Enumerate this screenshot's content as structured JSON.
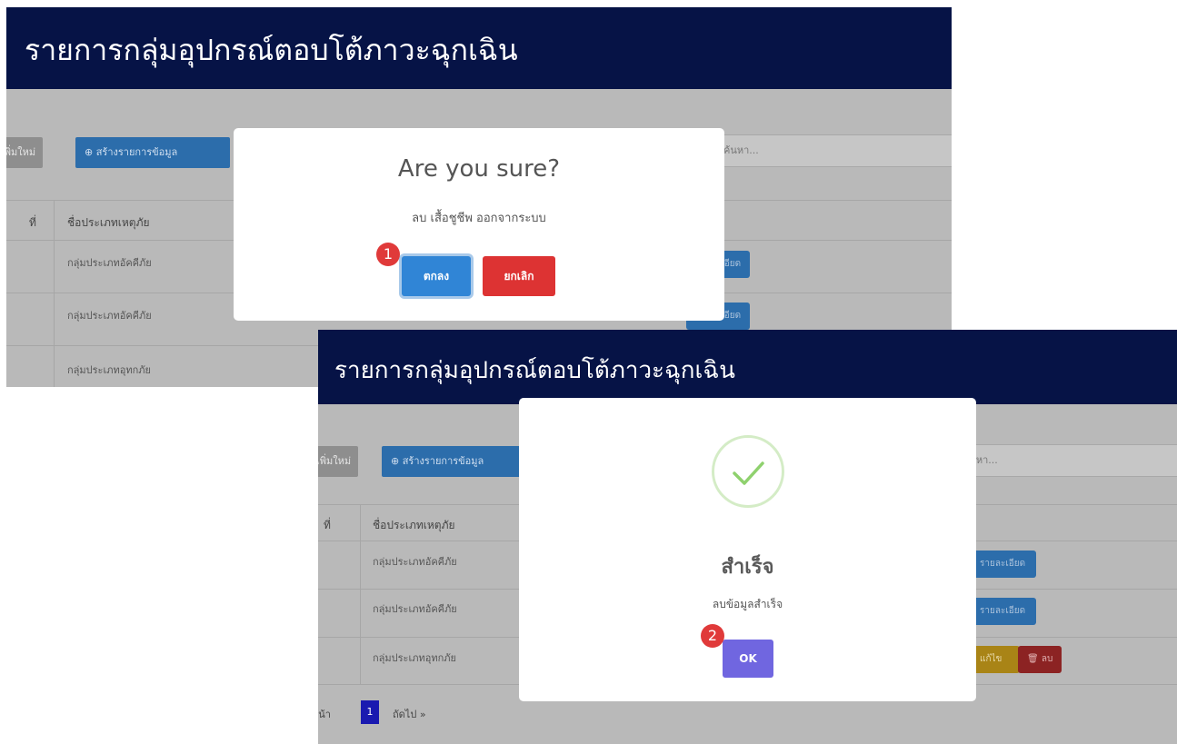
{
  "screen1": {
    "header_title": "รายการกลุ่มอุปกรณ์ตอบโต้ภาวะฉุกเฉิน",
    "toolbar": {
      "add_new_label": "เพิ่มใหม่",
      "create_label": "สร้างรายการข้อมูล",
      "search_placeholder": "ค้นหา..."
    },
    "table": {
      "col_no": "ที่",
      "col_name": "ชื่อประเภทเหตุภัย",
      "rows": [
        "กลุ่มประเภทอัคคีภัย",
        "กลุ่มประเภทอัคคีภัย",
        "กลุ่มประเภทอุทกภัย"
      ],
      "details_label": "รายละเอียด"
    },
    "dialog": {
      "title": "Are you sure?",
      "text": "ลบ เสื้อชูชีพ ออกจากระบบ",
      "confirm_label": "ตกลง",
      "cancel_label": "ยกเลิก",
      "step_number": "1",
      "confirm_color": "#3085d6",
      "cancel_color": "#dd3333"
    }
  },
  "screen2": {
    "header_title": "รายการกลุ่มอุปกรณ์ตอบโต้ภาวะฉุกเฉิน",
    "toolbar": {
      "add_new_label": "เพิ่มใหม่",
      "create_label": "สร้างรายการข้อมูล",
      "search_placeholder": "ค้นหา..."
    },
    "table": {
      "col_no": "ที่",
      "col_name": "ชื่อประเภทเหตุภัย",
      "rows": [
        "กลุ่มประเภทอัคคีภัย",
        "กลุ่มประเภทอัคคีภัย",
        "กลุ่มประเภทอุทกภัย"
      ],
      "details_label": "รายละเอียด",
      "edit_label": "แก้ไข",
      "delete_label": "ลบ"
    },
    "pagination": {
      "prev_label": "« ก่อนหน้า",
      "current_page": "1",
      "next_label": "ถัดไป »"
    },
    "dialog": {
      "icon": "success-check-icon",
      "title": "สำเร็จ",
      "text": "ลบข้อมูลสำเร็จ",
      "ok_label": "OK",
      "step_number": "2",
      "ok_color": "#7066e0"
    }
  }
}
